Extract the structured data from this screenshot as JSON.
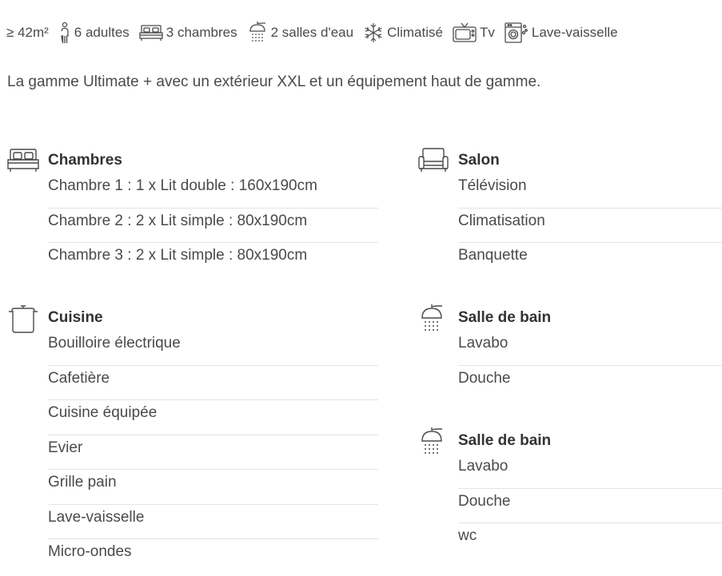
{
  "features": [
    {
      "icon": "area-icon",
      "label": "≥ 42m²"
    },
    {
      "icon": "person-icon",
      "label": "6 adultes"
    },
    {
      "icon": "bed-icon",
      "label": "3 chambres"
    },
    {
      "icon": "shower-icon",
      "label": "2 salles d'eau"
    },
    {
      "icon": "snowflake-icon",
      "label": "Climatisé"
    },
    {
      "icon": "tv-icon",
      "label": "Tv"
    },
    {
      "icon": "dishwasher-icon",
      "label": "Lave-vaisselle"
    }
  ],
  "description": "La gamme Ultimate + avec un extérieur XXL et un équipement haut de gamme.",
  "sections": {
    "chambres": {
      "title": "Chambres",
      "icon": "bed-icon",
      "items": [
        "Chambre 1 : 1 x Lit double : 160x190cm",
        "Chambre 2 : 2 x Lit simple : 80x190cm",
        "Chambre 3 : 2 x Lit simple : 80x190cm"
      ]
    },
    "salon": {
      "title": "Salon",
      "icon": "sofa-icon",
      "items": [
        "Télévision",
        "Climatisation",
        "Banquette"
      ]
    },
    "cuisine": {
      "title": "Cuisine",
      "icon": "cooking-pot-icon",
      "items": [
        "Bouilloire électrique",
        "Cafetière",
        "Cuisine équipée",
        "Evier",
        "Grille pain",
        "Lave-vaisselle",
        "Micro-ondes"
      ]
    },
    "salle_de_bain_1": {
      "title": "Salle de bain",
      "icon": "shower-icon",
      "items": [
        "Lavabo",
        "Douche"
      ]
    },
    "salle_de_bain_2": {
      "title": "Salle de bain",
      "icon": "shower-icon",
      "items": [
        "Lavabo",
        "Douche",
        "wc"
      ]
    }
  }
}
